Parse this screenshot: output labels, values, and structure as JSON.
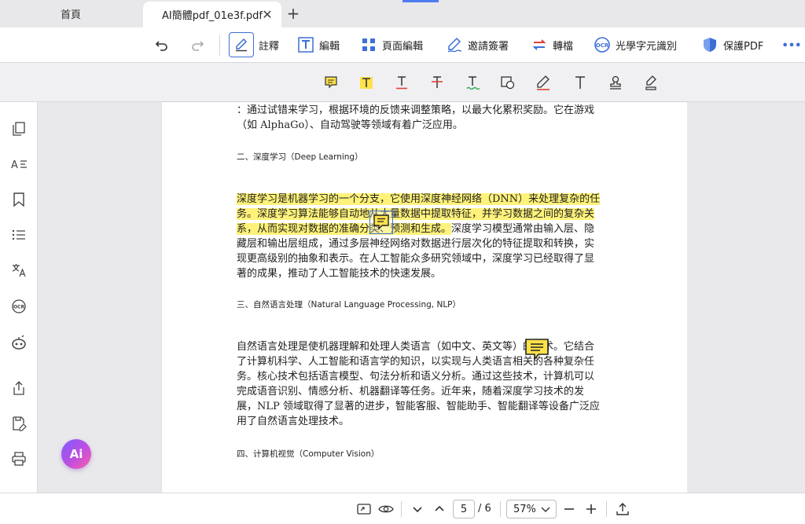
{
  "tabs": {
    "home_label": "首頁",
    "active_label": "AI簡體pdf_01e3f.pdf",
    "close_glyph": "✕",
    "new_tab_glyph": "+"
  },
  "toolbar": {
    "annotate_label": "註釋",
    "edit_label": "編輯",
    "page_edit_label": "頁面編輯",
    "sign_label": "邀請簽署",
    "convert_label": "轉檔",
    "ocr_label": "光學字元識別",
    "protect_label": "保護PDF",
    "more_glyph": "•••",
    "accent_color": "#3c6fd8"
  },
  "document": {
    "lines_top": [
      "：通过试错来学习，根据环境的反馈来调整策略，以最大化累积奖励。它在游戏",
      "（如 AlphaGo）、自动驾驶等领域有着广泛应用。"
    ],
    "heading_2": "二、深度学习（Deep Learning）",
    "dl_hl_1": "深度学习是机器学习的一个分支，它使用深度神经网络（DNN）来处理复杂的任",
    "dl_hl_2": "务。深度学习算法能够自动地从大量数据中提取特征，并学习数据之间的复杂关",
    "dl_hl_3": "系，从而实现对数据的准确分类、预测和生成。",
    "dl_rest_3": "深度学习模型通常由输入层、隐",
    "dl_lines": [
      "藏层和输出层组成，通过多层神经网络对数据进行层次化的特征提取和转换，实",
      "现更高级别的抽象和表示。在人工智能众多研究领域中，深度学习已经取得了显",
      "著的成果，推动了人工智能技术的快速发展。"
    ],
    "heading_3": "三、自然语言处理（Natural Language Processing, NLP）",
    "nlp_lines": [
      "自然语言处理是使机器理解和处理人类语言（如中文、英文等）的技术。它结合",
      "了计算机科学、人工智能和语言学的知识，以实现与人类语言相关的各种复杂任",
      "务。核心技术包括语言模型、句法分析和语义分析。通过这些技术，计算机可以",
      "完成语音识别、情感分析、机器翻译等任务。近年来，随着深度学习技术的发",
      "展，NLP 领域取得了显著的进步，智能客服、智能助手、智能翻译等设备广泛应",
      "用了自然语言处理技术。"
    ],
    "heading_4": "四、计算机视觉（Computer Vision）",
    "highlight_color": "#fff27a"
  },
  "ai_button": {
    "label": "Ai"
  },
  "bottom": {
    "current_page": "5",
    "total_pages": "/ 6",
    "zoom": "57%"
  }
}
